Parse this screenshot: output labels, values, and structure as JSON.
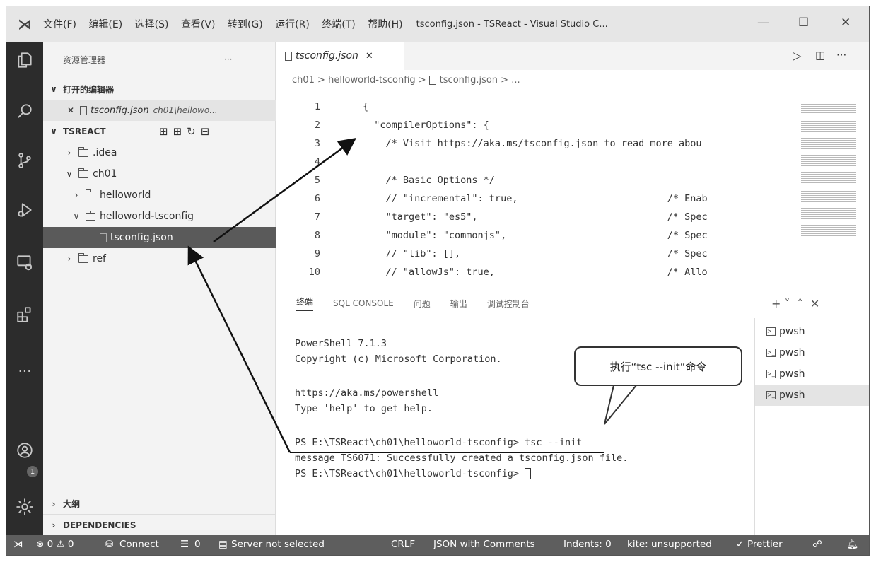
{
  "titlebar": {
    "menu": [
      "文件(F)",
      "编辑(E)",
      "选择(S)",
      "查看(V)",
      "转到(G)",
      "运行(R)",
      "终端(T)",
      "帮助(H)"
    ],
    "title": "tsconfig.json - TSReact - Visual Studio C...",
    "min": "—",
    "max": "☐",
    "close": "✕"
  },
  "sidebar": {
    "header": "资源管理器",
    "more": "···",
    "open_editors": "打开的编辑器",
    "open_file": "tsconfig.json",
    "open_path": "ch01\\hellowo...",
    "workspace": "TSREACT",
    "tree": [
      ".idea",
      "ch01",
      "helloworld",
      "helloworld-tsconfig",
      "tsconfig.json",
      "ref"
    ],
    "outline": "大纲",
    "dependencies": "DEPENDENCIES"
  },
  "editor": {
    "tab": "tsconfig.json",
    "breadcrumb": "ch01 > helloworld-tsconfig > ",
    "breadcrumb_file": "tsconfig.json > ...",
    "lines": [
      {
        "n": "1",
        "t": "{"
      },
      {
        "n": "2",
        "t": "  \"compilerOptions\": {"
      },
      {
        "n": "3",
        "t": "    /* Visit https://aka.ms/tsconfig.json to read more abou"
      },
      {
        "n": "4",
        "t": ""
      },
      {
        "n": "5",
        "t": "    /* Basic Options */"
      },
      {
        "n": "6",
        "t": "    // \"incremental\": true,                          /* Enab"
      },
      {
        "n": "7",
        "t": "    \"target\": \"es5\",                                 /* Spec"
      },
      {
        "n": "8",
        "t": "    \"module\": \"commonjs\",                            /* Spec"
      },
      {
        "n": "9",
        "t": "    // \"lib\": [],                                    /* Spec"
      },
      {
        "n": "10",
        "t": "    // \"allowJs\": true,                              /* Allo"
      }
    ]
  },
  "panel": {
    "tabs": [
      "终端",
      "SQL CONSOLE",
      "问题",
      "输出",
      "调试控制台"
    ],
    "controls": "+ ˅  ˄  ✕",
    "terminal": [
      "PowerShell 7.1.3",
      "Copyright (c) Microsoft Corporation.",
      "",
      "https://aka.ms/powershell",
      "Type 'help' to get help.",
      "",
      "PS E:\\TSReact\\ch01\\helloworld-tsconfig> tsc --init",
      "message TS6071: Successfully created a tsconfig.json file.",
      "PS E:\\TSReact\\ch01\\helloworld-tsconfig> "
    ],
    "terminals": [
      "pwsh",
      "pwsh",
      "pwsh",
      "pwsh"
    ]
  },
  "callout": "执行“tsc --init”命令",
  "status": {
    "errors": "⊗ 0 ⚠ 0",
    "connect": "Connect",
    "zero": "0",
    "server": "Server not selected",
    "eol": "CRLF",
    "lang": "JSON with Comments",
    "indent": "Indents: 0",
    "kite": "kite: unsupported",
    "prettier": "Prettier"
  },
  "badge": "1"
}
